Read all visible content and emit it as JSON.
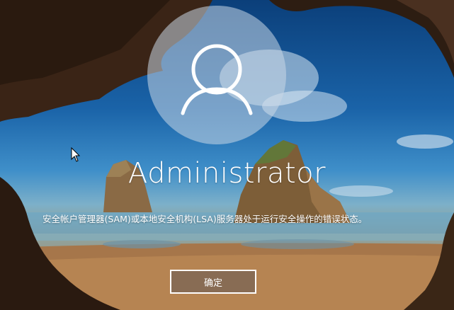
{
  "login": {
    "username": "Administrator",
    "message": "安全帐户管理器(SAM)或本地安全机构(LSA)服务器处于运行安全操作的错误状态。",
    "ok_button": "确定"
  },
  "icons": {
    "avatar": "user-silhouette-icon",
    "cursor": "mouse-pointer-icon"
  },
  "colors": {
    "text": "#ffffff",
    "avatar_bg": "#c8d7e6",
    "button_bg": "#786455"
  }
}
